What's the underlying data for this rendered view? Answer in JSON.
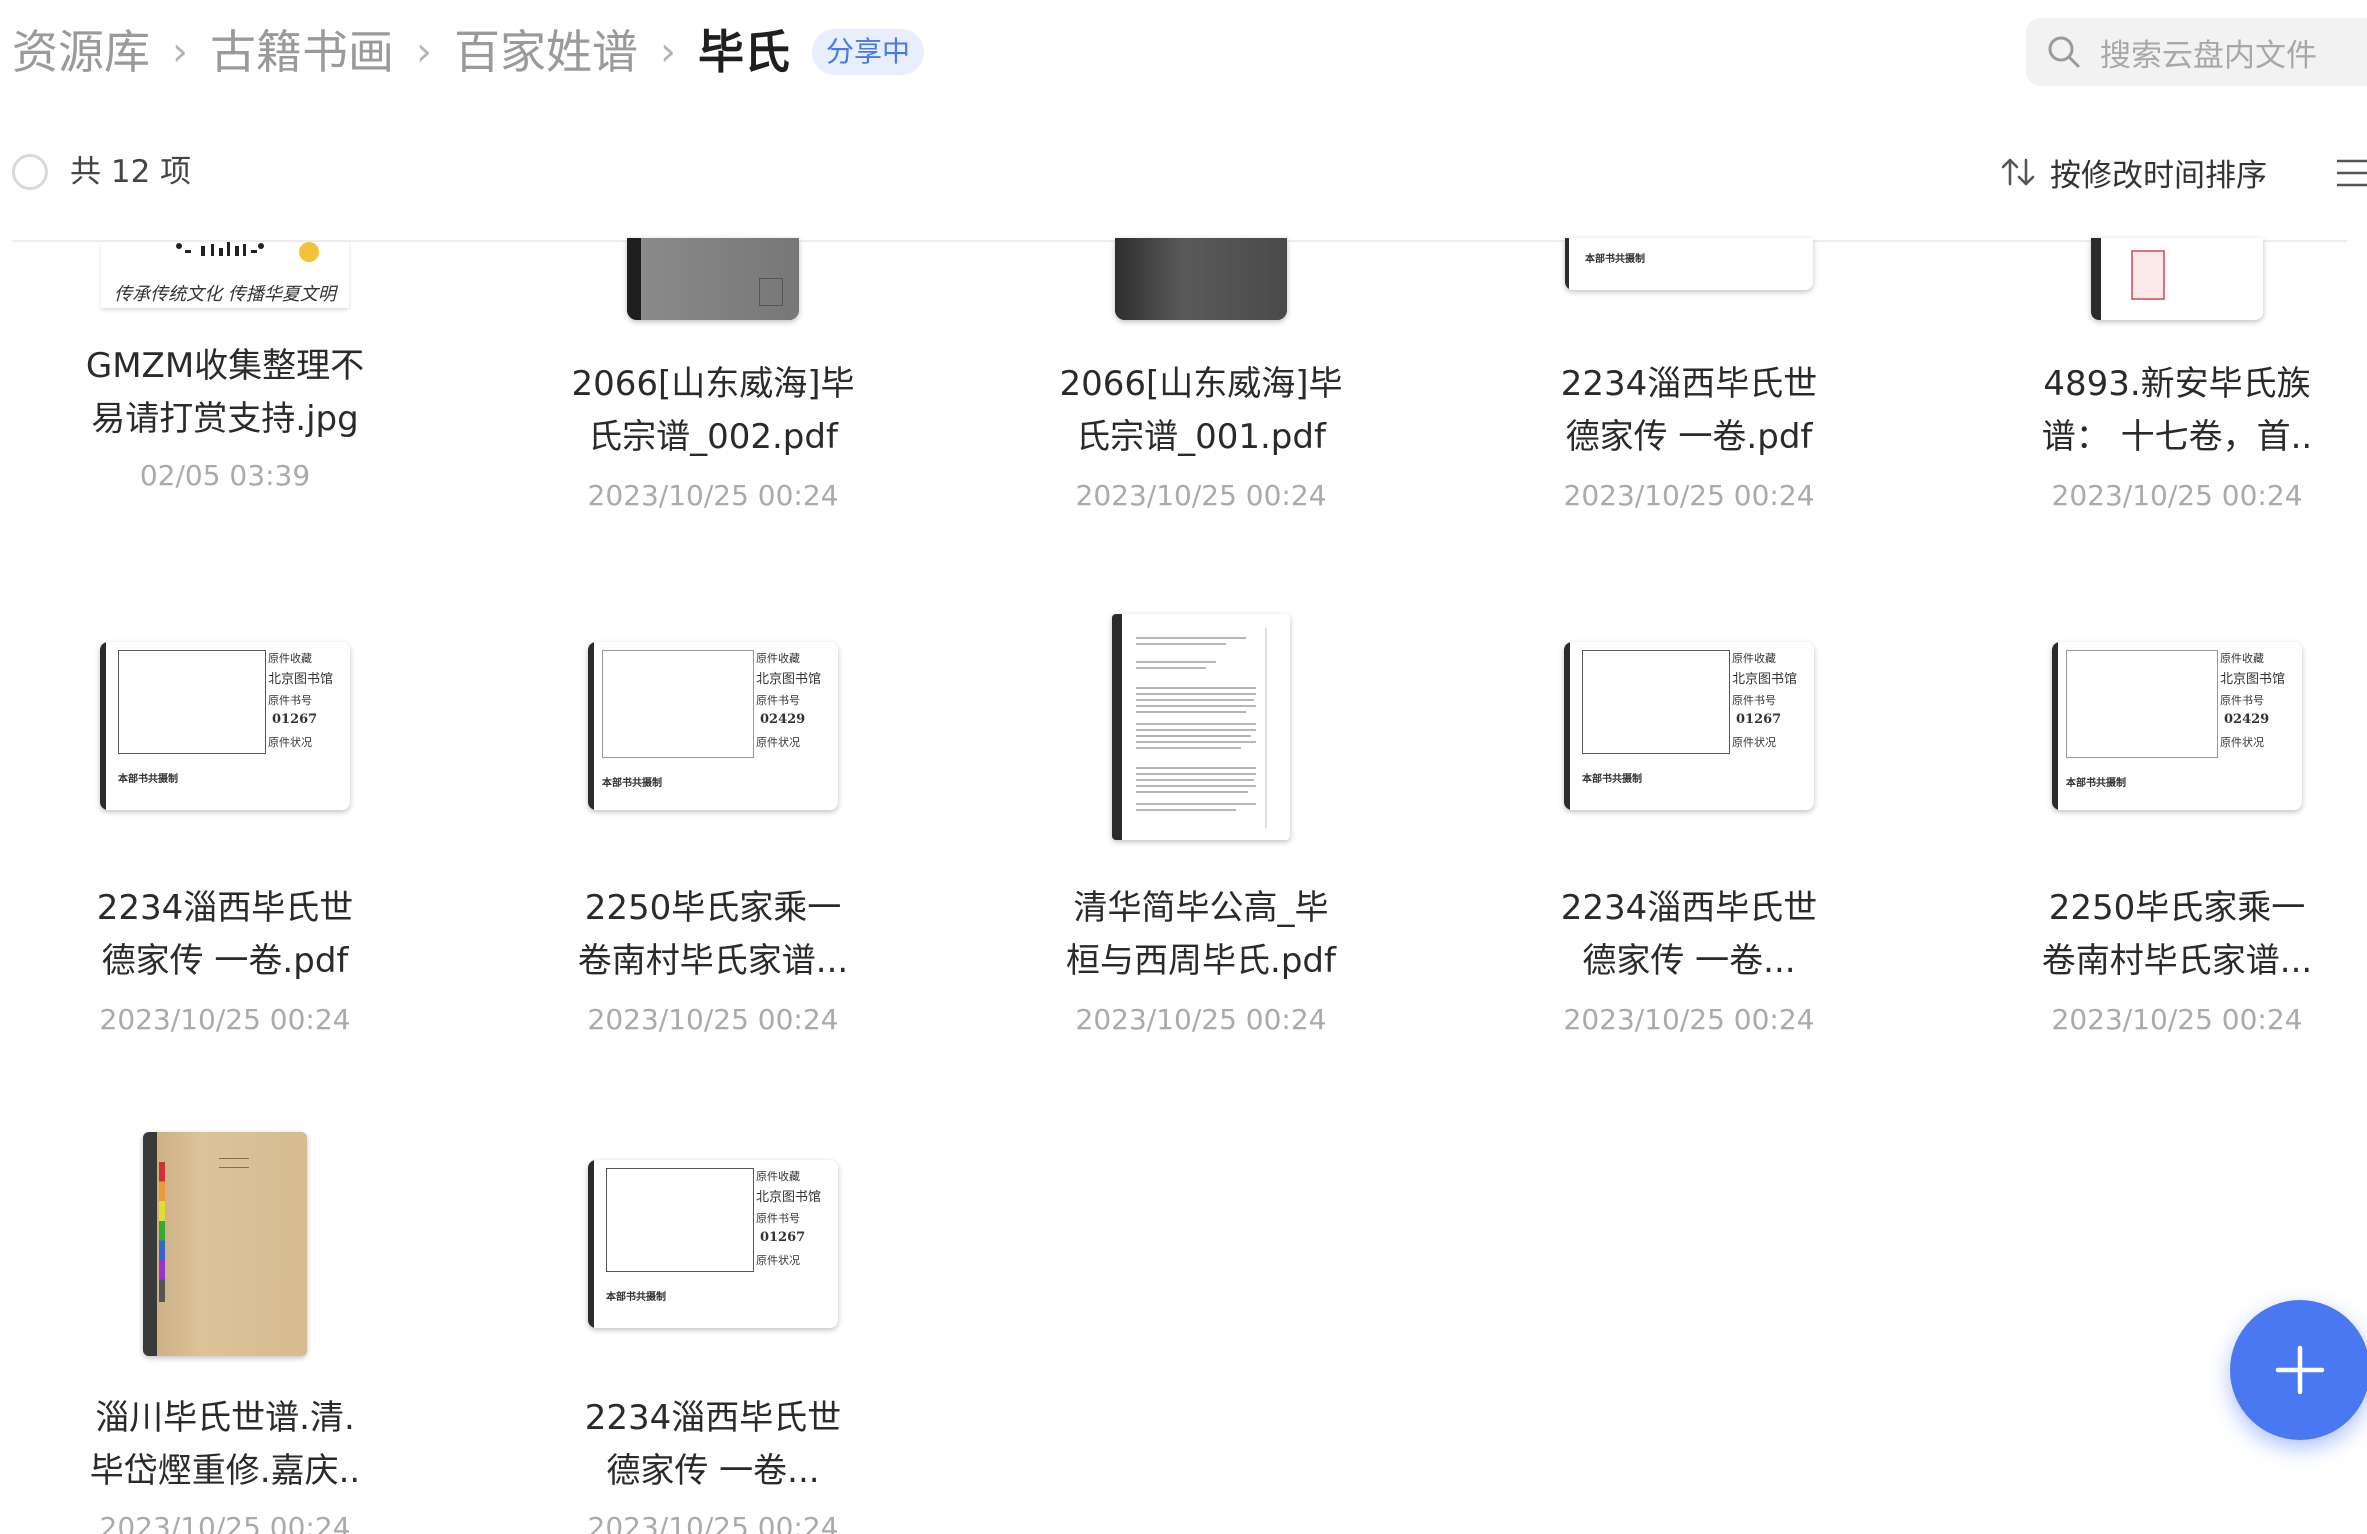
{
  "breadcrumb": {
    "items": [
      "资源库",
      "古籍书画",
      "百家姓谱"
    ],
    "current": "毕氏",
    "badge": "分享中",
    "separator": "›"
  },
  "search": {
    "placeholder": "搜索云盘内文件",
    "icon": "search-icon"
  },
  "toolbar": {
    "count_label": "共 12 项",
    "sort_label": "按修改时间排序"
  },
  "files": [
    {
      "name": "GMZM收集整理不\n易请打赏支持.jpg",
      "date": "02/05 03:39",
      "thumb": "qr-banner",
      "thumb_caption": "传承传统文化 传播华夏文明"
    },
    {
      "name": "2066[山东威海]毕\n氏宗谱_002.pdf",
      "date": "2023/10/25 00:24",
      "thumb": "gray-cover"
    },
    {
      "name": "2066[山东威海]毕\n氏宗谱_001.pdf",
      "date": "2023/10/25 00:24",
      "thumb": "dark-cover"
    },
    {
      "name": "2234淄西毕氏世\n德家传 一卷.pdf",
      "date": "2023/10/25 00:24",
      "thumb": "catalog-card-bottom"
    },
    {
      "name": "4893.新安毕氏族\n谱： 十七卷，首..",
      "date": "2023/10/25 00:24",
      "thumb": "seal-page"
    },
    {
      "name": "2234淄西毕氏世\n德家传 一卷.pdf",
      "date": "2023/10/25 00:24",
      "thumb": "catalog-card",
      "code": "01267"
    },
    {
      "name": "2250毕氏家乘一\n卷南村毕氏家谱...",
      "date": "2023/10/25 00:24",
      "thumb": "catalog-card",
      "code": "02429"
    },
    {
      "name": "清华简毕公高_毕\n桓与西周毕氏.pdf",
      "date": "2023/10/25 00:24",
      "thumb": "text-page"
    },
    {
      "name": "2234淄西毕氏世\n德家传 一卷...",
      "date": "2023/10/25 00:24",
      "thumb": "catalog-card",
      "code": "01267"
    },
    {
      "name": "2250毕氏家乘一\n卷南村毕氏家谱...",
      "date": "2023/10/25 00:24",
      "thumb": "catalog-card",
      "code": "02429"
    },
    {
      "name": "淄川毕氏世谱.清.\n毕岱熞重修.嘉庆..",
      "date": "2023/10/25 00:24",
      "thumb": "book-cover"
    },
    {
      "name": "2234淄西毕氏世\n德家传 一卷...",
      "date": "2023/10/25 00:24",
      "thumb": "catalog-card",
      "code": "01267"
    }
  ],
  "catalog_labels": {
    "collection": "原件收藏",
    "library": "北京图书馆",
    "book_no": "原件书号",
    "condition": "原件状况",
    "footer": "本部书共摄制"
  },
  "colors": {
    "accent": "#4a78f0",
    "badge_bg": "#e8eefc",
    "badge_text": "#4a78e8"
  }
}
